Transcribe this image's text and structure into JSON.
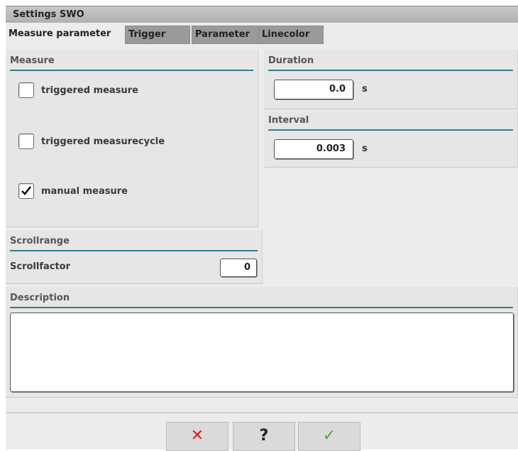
{
  "window": {
    "title": "Settings SWO"
  },
  "tabs": [
    {
      "label": "Measure parameter",
      "active": true
    },
    {
      "label": "Trigger",
      "active": false
    },
    {
      "label": "Parameter",
      "active": false
    },
    {
      "label": "Linecolor",
      "active": false
    }
  ],
  "measure": {
    "title": "Measure",
    "options": [
      {
        "label": "triggered measure",
        "checked": false
      },
      {
        "label": "triggered measurecycle",
        "checked": false
      },
      {
        "label": "manual measure",
        "checked": true
      }
    ]
  },
  "duration": {
    "title": "Duration",
    "value": "0.0",
    "unit": "s"
  },
  "interval": {
    "title": "Interval",
    "value": "0.003",
    "unit": "s"
  },
  "scrollrange": {
    "title": "Scrollrange",
    "label": "Scrollfactor",
    "value": "0"
  },
  "description": {
    "title": "Description",
    "value": ""
  },
  "buttons": {
    "cancel": {
      "glyph": "✕",
      "color": "#e02020"
    },
    "help": {
      "glyph": "?"
    },
    "ok": {
      "glyph": "✓",
      "color": "#5aa02c"
    }
  },
  "colors": {
    "accent_rule": "#2e7f85"
  }
}
